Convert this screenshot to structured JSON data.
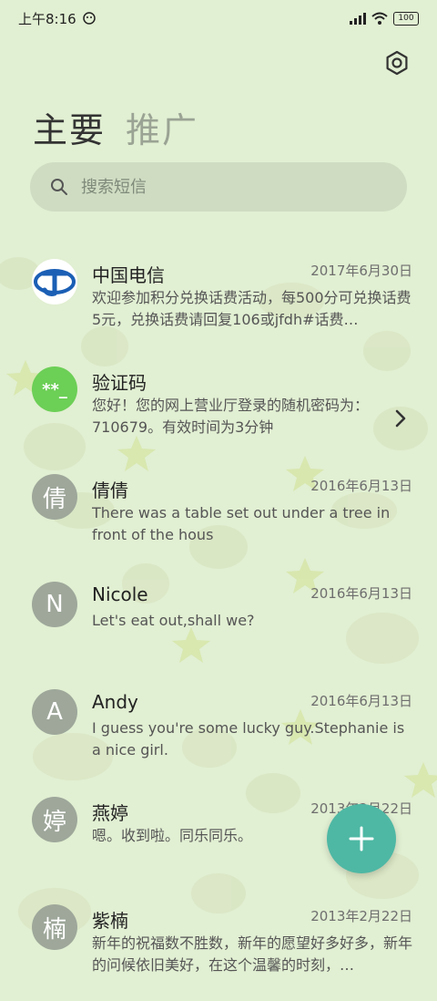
{
  "status": {
    "time": "上午8:16",
    "battery": "100"
  },
  "tabs": [
    {
      "label": "主要"
    },
    {
      "label": "推广"
    }
  ],
  "search": {
    "placeholder": "搜索短信"
  },
  "conversations": [
    {
      "name": "中国电信",
      "date": "2017年6月30日",
      "message": "欢迎参加积分兑换话费活动，每500分可兑换话费5元，兑换话费请回复106或jfdh#话费…",
      "avatar": "telecom-logo"
    },
    {
      "name": "验证码",
      "date": "",
      "message": "您好！您的网上营业厅登录的随机密码为：710679。有效时间为3分钟",
      "avatar_text": "**_"
    },
    {
      "name": "倩倩",
      "date": "2016年6月13日",
      "message": "There was a table set out under a tree in front of the hous",
      "avatar_text": "倩"
    },
    {
      "name": "Nicole",
      "date": "2016年6月13日",
      "message": "Let's eat out,shall we?",
      "avatar_text": "N"
    },
    {
      "name": "Andy",
      "date": "2016年6月13日",
      "message": "I guess you're some lucky guy.Stephanie is a nice girl.",
      "avatar_text": "A"
    },
    {
      "name": "燕婷",
      "date": "2013年2月22日",
      "message": "嗯。收到啦。同乐同乐。",
      "avatar_text": "婷"
    },
    {
      "name": "紫楠",
      "date": "2013年2月22日",
      "message": "新年的祝福数不胜数，新年的愿望好多好多，新年的问候依旧美好，在这个温馨的时刻，…",
      "avatar_text": "楠"
    }
  ],
  "icons": {
    "settings": "settings-hexagon-icon",
    "search": "search-icon",
    "compose": "plus-icon",
    "chevron": "chevron-right-icon"
  },
  "colors": {
    "background": "#e1efd2",
    "fab": "#4eb8a4",
    "verification_avatar": "#6ccf56",
    "avatar_gray": "#9ea79a"
  }
}
